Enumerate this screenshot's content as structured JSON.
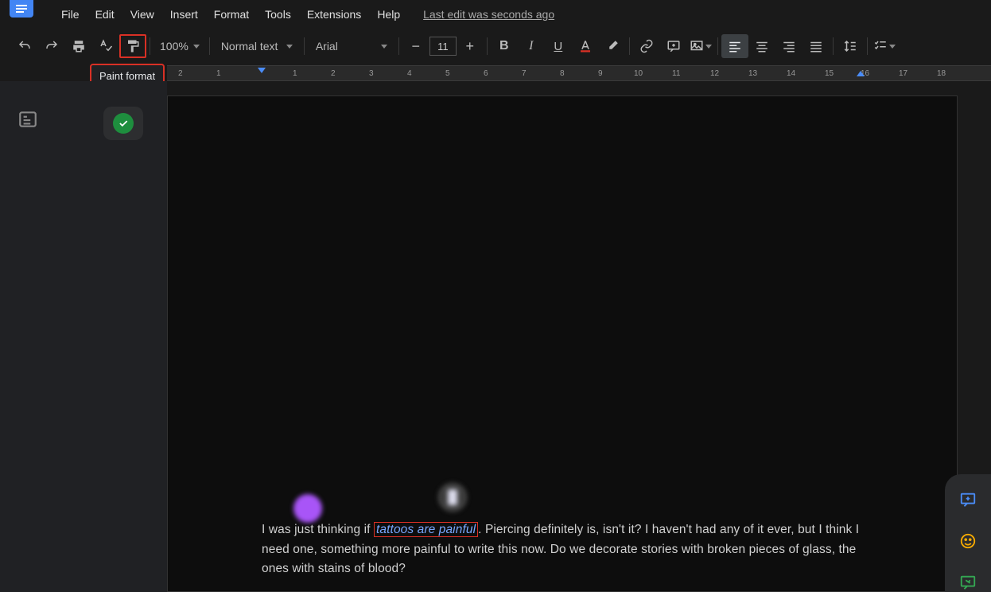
{
  "app_icon": "docs-icon",
  "menu": {
    "file": "File",
    "edit": "Edit",
    "view": "View",
    "insert": "Insert",
    "format": "Format",
    "tools": "Tools",
    "extensions": "Extensions",
    "help": "Help",
    "last_edit": "Last edit was seconds ago"
  },
  "toolbar": {
    "zoom": "100%",
    "style": "Normal text",
    "font": "Arial",
    "font_size": "11"
  },
  "tooltip": {
    "paint_format": "Paint format"
  },
  "ruler": {
    "ticks": [
      "2",
      "1",
      "",
      "1",
      "2",
      "3",
      "4",
      "5",
      "6",
      "7",
      "8",
      "9",
      "10",
      "11",
      "12",
      "13",
      "14",
      "15",
      "16",
      "17",
      "18"
    ]
  },
  "document": {
    "p1_pre": "I was just thinking if ",
    "p1_highlight": "tattoos are painful",
    "p1_post": ". Piercing definitely is, isn't it? I haven't had any of it ever, but I think I need one, something more painful to write this now. Do we decorate stories with broken pieces of glass, the ones with stains of blood?"
  }
}
